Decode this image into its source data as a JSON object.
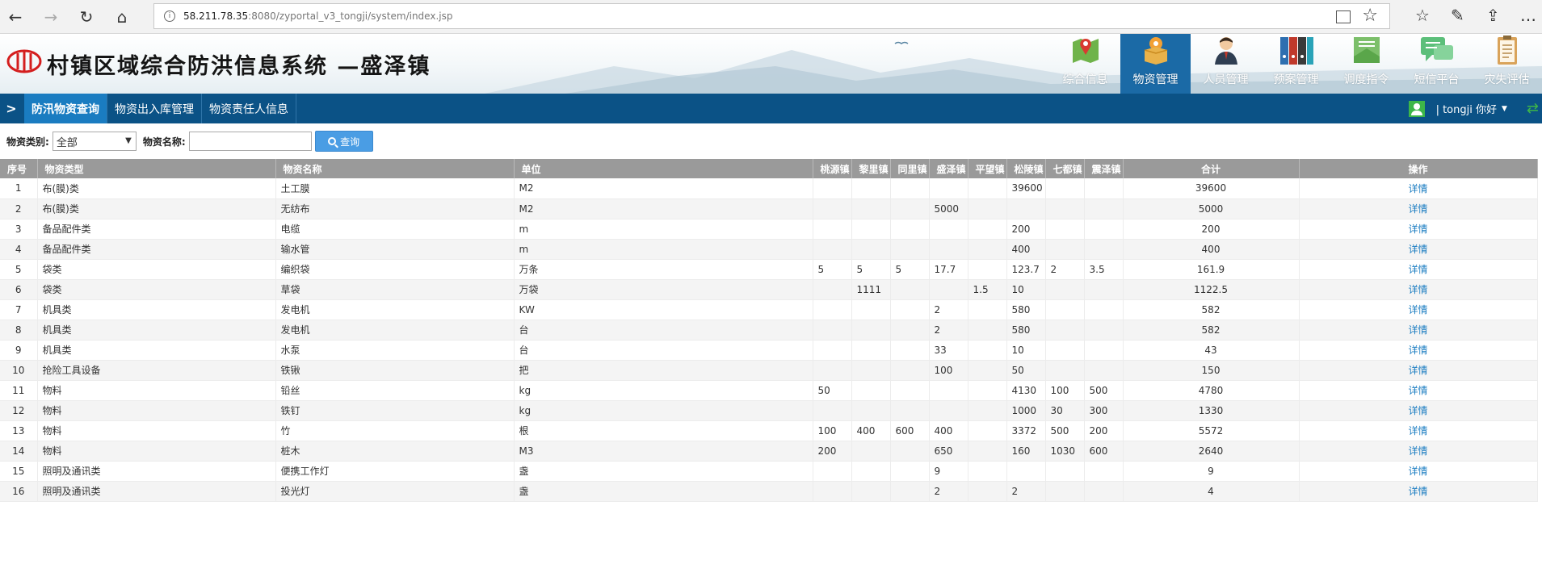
{
  "browser": {
    "url_host": "58.211.78.35",
    "url_rest": ":8080/zyportal_v3_tongji/system/index.jsp"
  },
  "header": {
    "title": "村镇区域综合防洪信息系统 —盛泽镇",
    "modules": [
      {
        "label": "综合信息",
        "icon": "map-pin-icon"
      },
      {
        "label": "物资管理",
        "icon": "supplies-box-icon"
      },
      {
        "label": "人员管理",
        "icon": "person-icon"
      },
      {
        "label": "预案管理",
        "icon": "binders-icon"
      },
      {
        "label": "调度指令",
        "icon": "envelope-icon"
      },
      {
        "label": "短信平台",
        "icon": "chat-bubble-icon"
      },
      {
        "label": "灾失评估",
        "icon": "clipboard-icon"
      }
    ],
    "active_module": "物资管理"
  },
  "subnav": {
    "arrow": ">",
    "tabs": [
      "防汛物资查询",
      "物资出入库管理",
      "物资责任人信息"
    ],
    "user_text": "| tongji  你好"
  },
  "search": {
    "category_label": "物资类别:",
    "category_value": "全部",
    "name_label": "物资名称:",
    "name_value": "",
    "query_button": "查询"
  },
  "table": {
    "headers": [
      "序号",
      "物资类型",
      "物资名称",
      "单位",
      "桃源镇",
      "黎里镇",
      "同里镇",
      "盛泽镇",
      "平望镇",
      "松陵镇",
      "七都镇",
      "震泽镇",
      "合计",
      "操作"
    ],
    "rows": [
      [
        "1",
        "布(膜)类",
        "土工膜",
        "M2",
        "",
        "",
        "",
        "",
        "",
        "39600",
        "",
        "",
        "39600",
        "详情"
      ],
      [
        "2",
        "布(膜)类",
        "无纺布",
        "M2",
        "",
        "",
        "",
        "5000",
        "",
        "",
        "",
        "",
        "5000",
        "详情"
      ],
      [
        "3",
        "备品配件类",
        "电缆",
        "m",
        "",
        "",
        "",
        "",
        "",
        "200",
        "",
        "",
        "200",
        "详情"
      ],
      [
        "4",
        "备品配件类",
        "输水管",
        "m",
        "",
        "",
        "",
        "",
        "",
        "400",
        "",
        "",
        "400",
        "详情"
      ],
      [
        "5",
        "袋类",
        "编织袋",
        "万条",
        "5",
        "5",
        "5",
        "17.7",
        "",
        "123.7",
        "2",
        "3.5",
        "161.9",
        "详情"
      ],
      [
        "6",
        "袋类",
        "草袋",
        "万袋",
        "",
        "1111",
        "",
        "",
        "1.5",
        "10",
        "",
        "",
        "1122.5",
        "详情"
      ],
      [
        "7",
        "机具类",
        "发电机",
        "KW",
        "",
        "",
        "",
        "2",
        "",
        "580",
        "",
        "",
        "582",
        "详情"
      ],
      [
        "8",
        "机具类",
        "发电机",
        "台",
        "",
        "",
        "",
        "2",
        "",
        "580",
        "",
        "",
        "582",
        "详情"
      ],
      [
        "9",
        "机具类",
        "水泵",
        "台",
        "",
        "",
        "",
        "33",
        "",
        "10",
        "",
        "",
        "43",
        "详情"
      ],
      [
        "10",
        "抢险工具设备",
        "铁锹",
        "把",
        "",
        "",
        "",
        "100",
        "",
        "50",
        "",
        "",
        "150",
        "详情"
      ],
      [
        "11",
        "物料",
        "铅丝",
        "kg",
        "50",
        "",
        "",
        "",
        "",
        "4130",
        "100",
        "500",
        "4780",
        "详情"
      ],
      [
        "12",
        "物料",
        "铁钉",
        "kg",
        "",
        "",
        "",
        "",
        "",
        "1000",
        "30",
        "300",
        "1330",
        "详情"
      ],
      [
        "13",
        "物料",
        "竹",
        "根",
        "100",
        "400",
        "600",
        "400",
        "",
        "3372",
        "500",
        "200",
        "5572",
        "详情"
      ],
      [
        "14",
        "物料",
        "桩木",
        "M3",
        "200",
        "",
        "",
        "650",
        "",
        "160",
        "1030",
        "600",
        "2640",
        "详情"
      ],
      [
        "15",
        "照明及通讯类",
        "便携工作灯",
        "盏",
        "",
        "",
        "",
        "9",
        "",
        "",
        "",
        "",
        "9",
        "详情"
      ],
      [
        "16",
        "照明及通讯类",
        "投光灯",
        "盏",
        "",
        "",
        "",
        "2",
        "",
        "2",
        "",
        "",
        "4",
        "详情"
      ]
    ]
  }
}
